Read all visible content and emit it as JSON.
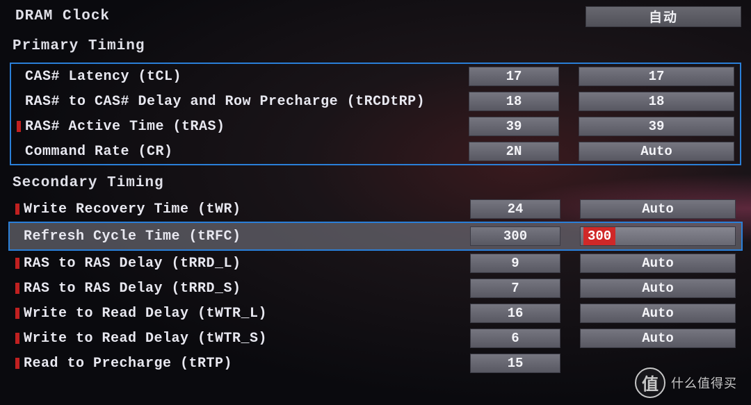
{
  "header": {
    "dram_clock": "DRAM Clock",
    "auto_button": "自动"
  },
  "primary": {
    "title": "Primary Timing",
    "rows": [
      {
        "label": "CAS# Latency (tCL)",
        "current": "17",
        "set": "17"
      },
      {
        "label": "RAS# to CAS# Delay and Row Precharge (tRCDtRP)",
        "current": "18",
        "set": "18"
      },
      {
        "label": "RAS# Active Time (tRAS)",
        "current": "39",
        "set": "39"
      },
      {
        "label": "Command Rate (CR)",
        "current": "2N",
        "set": "Auto"
      }
    ]
  },
  "secondary": {
    "title": "Secondary Timing",
    "rows": [
      {
        "label": "Write Recovery Time (tWR)",
        "current": "24",
        "set": "Auto"
      },
      {
        "label": "Refresh Cycle Time (tRFC)",
        "current": "300",
        "set": "300",
        "highlighted": true
      },
      {
        "label": "RAS to RAS Delay (tRRD_L)",
        "current": "9",
        "set": "Auto"
      },
      {
        "label": "RAS to RAS Delay (tRRD_S)",
        "current": "7",
        "set": "Auto"
      },
      {
        "label": "Write to Read Delay (tWTR_L)",
        "current": "16",
        "set": "Auto"
      },
      {
        "label": "Write to Read Delay (tWTR_S)",
        "current": "6",
        "set": "Auto"
      },
      {
        "label": "Read to Precharge (tRTP)",
        "current": "15",
        "set": ""
      }
    ]
  },
  "watermark": {
    "badge": "值",
    "text": "什么值得买"
  }
}
